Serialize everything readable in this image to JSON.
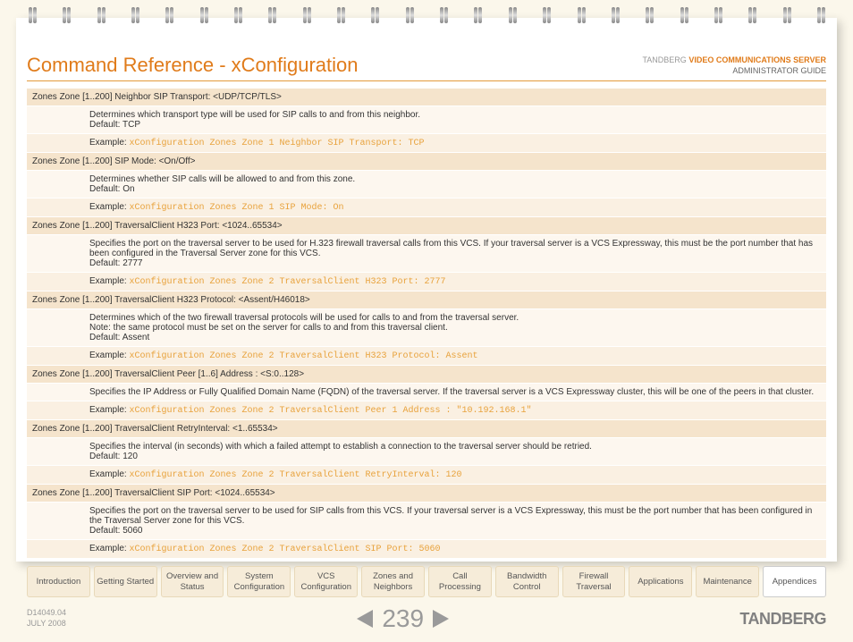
{
  "header": {
    "title": "Command Reference - xConfiguration",
    "brand": "TANDBERG",
    "product": "VIDEO COMMUNICATIONS SERVER",
    "guide": "ADMINISTRATOR GUIDE"
  },
  "rows": [
    {
      "head": "Zones Zone [1..200] Neighbor SIP Transport: <UDP/TCP/TLS>",
      "desc": "Determines which transport type will be used for SIP calls to and from this neighbor.",
      "default": "Default: TCP",
      "example": "xConfiguration Zones Zone 1 Neighbor SIP Transport: TCP"
    },
    {
      "head": "Zones Zone [1..200] SIP Mode: <On/Off>",
      "desc": "Determines whether SIP calls will be allowed to and from this zone.",
      "default": "Default: On",
      "example": "xConfiguration Zones Zone 1 SIP Mode: On"
    },
    {
      "head": "Zones Zone [1..200] TraversalClient H323 Port: <1024..65534>",
      "desc": "Specifies the port on the traversal server to be used for H.323 firewall traversal calls from this VCS. If your traversal server is a VCS Expressway, this must be the port number that has been configured in the Traversal Server zone for this VCS.",
      "default": "Default: 2777",
      "example": "xConfiguration Zones Zone 2 TraversalClient H323 Port: 2777"
    },
    {
      "head": "Zones Zone [1..200] TraversalClient H323 Protocol: <Assent/H46018>",
      "desc": "Determines which of the two firewall traversal protocols will be used for calls to and from the traversal server.",
      "note": "Note: the same protocol must be set on the server for calls to and from this traversal client.",
      "default": "Default: Assent",
      "example": "xConfiguration Zones Zone 2 TraversalClient H323 Protocol: Assent"
    },
    {
      "head": "Zones Zone [1..200] TraversalClient Peer [1..6] Address : <S:0..128>",
      "desc": "Specifies the IP Address or Fully Qualified Domain Name (FQDN) of the traversal server. If the traversal server is a VCS Expressway cluster, this will be one of the peers in that cluster.",
      "example": "xConfiguration Zones Zone 2 TraversalClient Peer 1 Address : \"10.192.168.1\""
    },
    {
      "head": "Zones Zone [1..200] TraversalClient RetryInterval: <1..65534>",
      "desc": "Specifies the interval (in seconds) with which a failed attempt to establish a connection to the traversal server should be retried.",
      "default": "Default: 120",
      "example": "xConfiguration Zones Zone 2 TraversalClient RetryInterval: 120"
    },
    {
      "head": "Zones Zone [1..200] TraversalClient SIP Port: <1024..65534>",
      "desc": "Specifies the port on the traversal server to be used for SIP calls from this VCS. If your traversal server is a VCS Expressway, this must be the port number that has been configured in the Traversal Server zone for this VCS.",
      "default": "Default: 5060",
      "example": "xConfiguration Zones Zone 2 TraversalClient SIP Port: 5060"
    }
  ],
  "example_label": "Example:",
  "tabs": [
    "Introduction",
    "Getting Started",
    "Overview and Status",
    "System Configuration",
    "VCS Configuration",
    "Zones and Neighbors",
    "Call Processing",
    "Bandwidth Control",
    "Firewall Traversal",
    "Applications",
    "Maintenance",
    "Appendices"
  ],
  "active_tab": 11,
  "footer": {
    "docid": "D14049.04",
    "date": "JULY 2008",
    "page": "239",
    "logo": "TANDBERG"
  }
}
